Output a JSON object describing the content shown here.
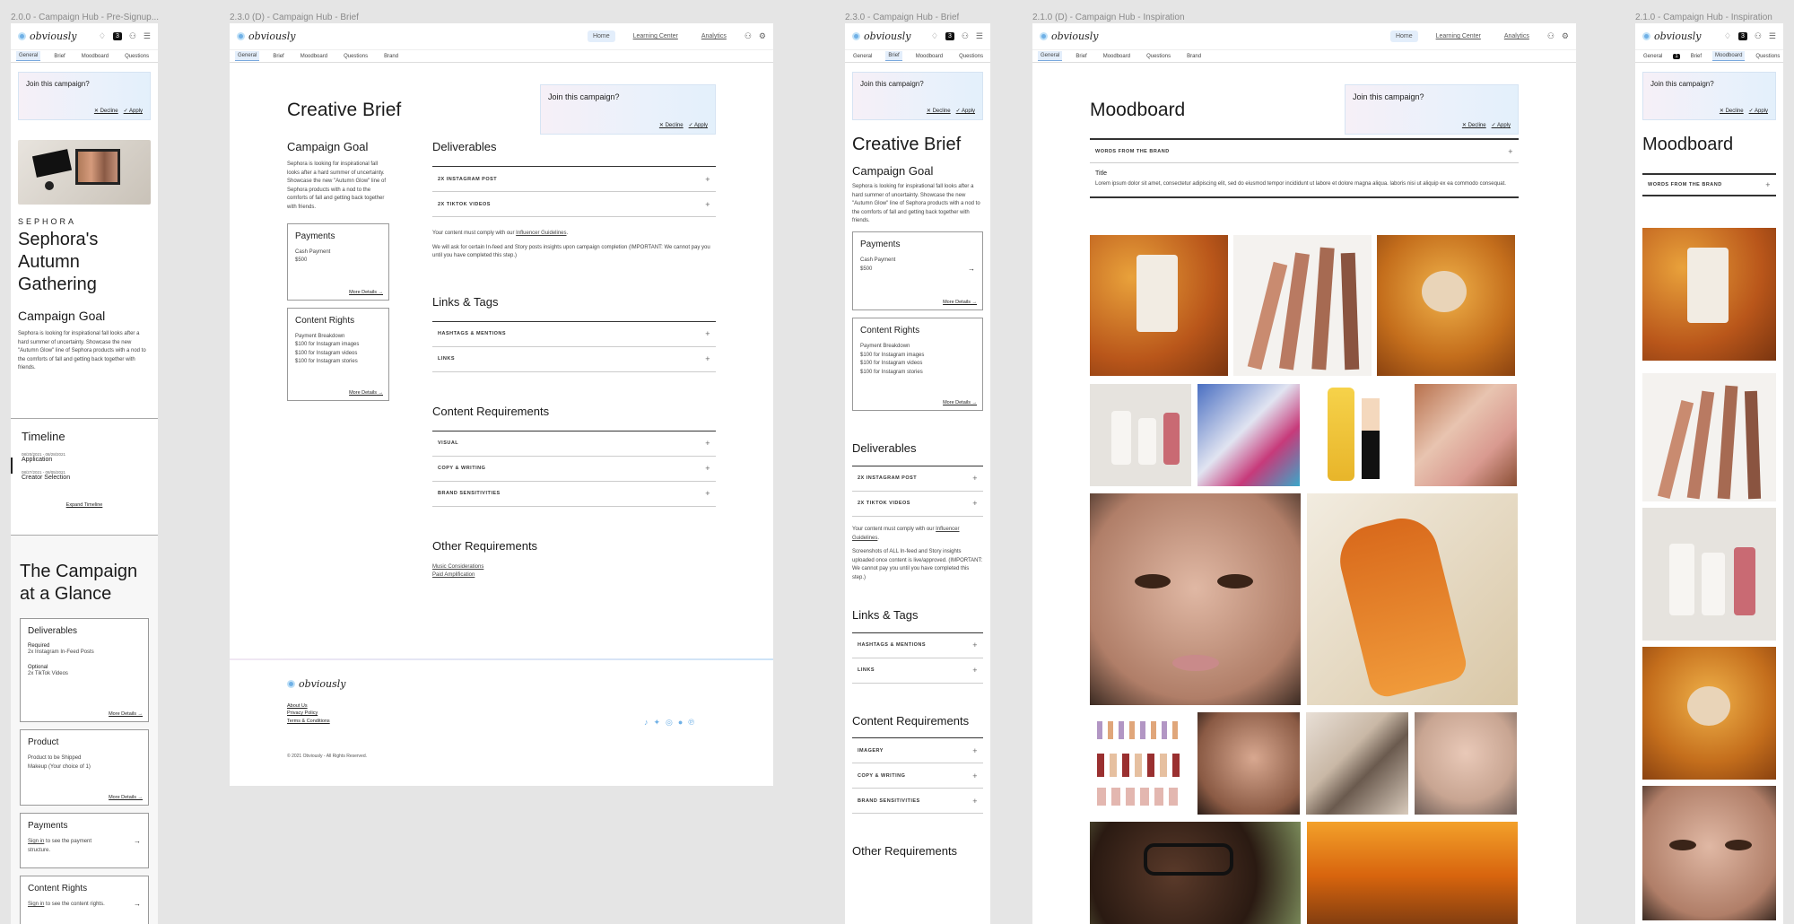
{
  "frames": {
    "f1": "2.0.0 - Campaign Hub - Pre-Signup...",
    "f2": "2.3.0 (D) - Campaign Hub - Brief",
    "f3": "2.3.0 - Campaign Hub - Brief",
    "f4": "2.1.0 (D) - Campaign Hub - Inspiration",
    "f5": "2.1.0 - Campaign Hub - Inspiration"
  },
  "brand": {
    "logo_text": "obviously",
    "badge_count": "3"
  },
  "nav": {
    "home": "Home",
    "learning": "Learning Center",
    "analytics": "Analytics"
  },
  "tabs": {
    "general": "General",
    "brief": "Brief",
    "moodboard": "Moodboard",
    "questions": "Questions",
    "brand": "Brand",
    "count": "1"
  },
  "join": {
    "question": "Join this campaign?",
    "decline": "Decline",
    "apply": "Apply"
  },
  "campaign": {
    "brand": "SEPHORA",
    "title": "Sephora's Autumn Gathering",
    "goal_title": "Campaign Goal",
    "goal_text": "Sephora is looking for inspirational fall looks after a hard summer of uncertainty. Showcase the new \"Autumn Glow\" line of Sephora products with a nod to the comforts of fall and getting back together with friends."
  },
  "timeline": {
    "title": "Timeline",
    "items": [
      {
        "date": "08/20/2021 - 08/28/2021",
        "label": "Application"
      },
      {
        "date": "08/27/2021 - 08/05/2021",
        "label": "Creator Selection"
      }
    ],
    "expand": "Expand Timeline"
  },
  "glance": {
    "title": "The Campaign at a Glance",
    "deliverables": {
      "title": "Deliverables",
      "req_label": "Required",
      "req_value": "2x Instagram In-Feed Posts",
      "opt_label": "Optional",
      "opt_value": "2x TikTok Videos"
    },
    "product": {
      "title": "Product",
      "sub": "Product to be Shipped",
      "value": "Makeup (Your choice of 1)"
    },
    "payments": {
      "title": "Payments",
      "text_link": "Sign in",
      "text": " to see the payment structure."
    },
    "rights": {
      "title": "Content Rights",
      "text_link": "Sign in",
      "text": " to see the content rights."
    },
    "more": "More Details"
  },
  "brief": {
    "title": "Creative Brief",
    "payments": {
      "title": "Payments",
      "label": "Cash Payment",
      "value": "$500"
    },
    "rights": {
      "title": "Content Rights",
      "label": "Payment Breakdown",
      "lines": [
        "$100 for Instagram images",
        "$100 for Instagram videos",
        "$100 for Instagram stories"
      ]
    },
    "deliverables_title": "Deliverables",
    "deliverables": [
      "2X INSTAGRAM POST",
      "2X TIKTOK VIDEOS"
    ],
    "comply_pre": "Your content must comply with our ",
    "comply_link": "Influencer Guidelines",
    "comply_post": ".",
    "insights": "We will ask for certain In-feed and Story posts insights upon campaign completion (IMPORTANT: We cannot pay you until you have completed this step.)",
    "insights_m": "Screenshots of ALL In-feed and Story insights uploaded once content is live/approved. (IMPORTANT: We cannot pay you until you have completed this step.)",
    "links_title": "Links & Tags",
    "links": [
      "HASHTAGS & MENTIONS",
      "LINKS"
    ],
    "req_title": "Content Requirements",
    "reqs": [
      "VISUAL",
      "COPY & WRITING",
      "BRAND SENSITIVITIES"
    ],
    "reqs_m": [
      "IMAGERY",
      "COPY & WRITING",
      "BRAND SENSITIVITIES"
    ],
    "other_title": "Other Requirements",
    "other": [
      "Music Considerations",
      "Paid Amplification"
    ]
  },
  "footer": {
    "links": [
      "About Us",
      "Privacy Policy",
      "Terms & Conditions"
    ],
    "copyright": "© 2021 Obviously - All Rights Reserved."
  },
  "mood": {
    "title": "Moodboard",
    "words_label": "WORDS FROM THE BRAND",
    "item_title": "Title",
    "item_text": "Lorem ipsum dolor sit amet, consectetur adipiscing elit, sed do eiusmod tempor incididunt ut labore et dolore magna aliqua. laboris nisi ut aliquip ex ea commodo consequat."
  },
  "colors": {
    "accent": "#6fb0e6",
    "tab_active": "#e3eefb"
  }
}
